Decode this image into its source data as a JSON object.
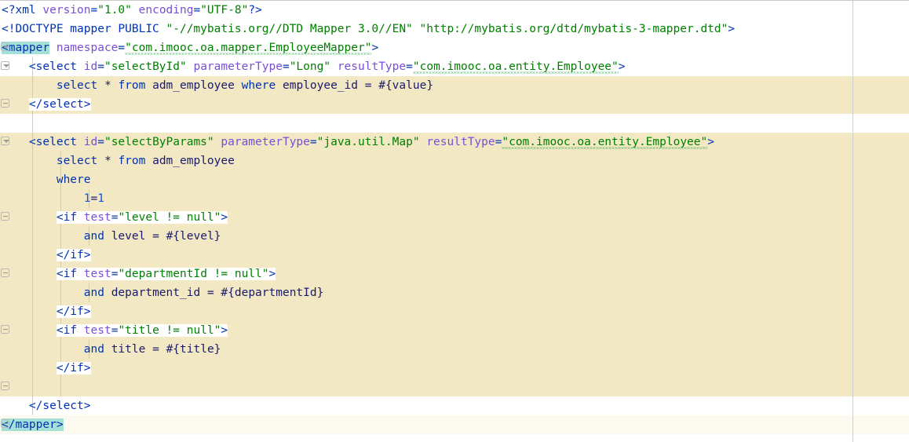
{
  "editor": {
    "kind": "xml-code-editor",
    "file_language": "XML",
    "font_size_px": 14.5,
    "line_height_px": 24,
    "colors": {
      "background": "#ffffff",
      "highlight_band": "#f2e8c3",
      "caret_line": "#fcfaef",
      "tag_selection": "#a5e0d8",
      "tag_name": "#0033b3",
      "attribute_name": "#7a4fd6",
      "attribute_value": "#008000",
      "sql_keyword": "#0033b3",
      "sql_identifier": "#1a1a6e",
      "number": "#1750eb",
      "indent_guide": "#cfcbbb",
      "margin_rule": "#cfcfcf",
      "fold_marker": "#b9b9b9",
      "spellcheck_squiggle": "#2fa84f"
    },
    "margin_rule_x": 1086,
    "indent_guides_x": [
      41,
      77,
      113
    ],
    "gutter": {
      "fold_markers": [
        {
          "line": 3,
          "state": "expanded"
        },
        {
          "line": 4,
          "state": "expanded"
        },
        {
          "line": 6,
          "state": "end"
        },
        {
          "line": 8,
          "state": "expanded"
        },
        {
          "line": 12,
          "state": "end"
        },
        {
          "line": 15,
          "state": "end"
        },
        {
          "line": 18,
          "state": "end"
        },
        {
          "line": 21,
          "state": "end"
        },
        {
          "line": 23,
          "state": "end"
        }
      ]
    },
    "highlight_bands": [
      {
        "from_line": 5,
        "to_line": 6,
        "type": "block"
      },
      {
        "from_line": 8,
        "to_line": 21,
        "type": "block"
      },
      {
        "from_line": 23,
        "to_line": 23,
        "type": "caret"
      }
    ],
    "lines": [
      {
        "n": 1,
        "text": "<?xml version=\"1.0\" encoding=\"UTF-8\"?>",
        "runs": [
          {
            "t": "<?xml ",
            "c": "pi"
          },
          {
            "t": "version",
            "c": "attrname"
          },
          {
            "t": "=",
            "c": "eq"
          },
          {
            "t": "\"1.0\"",
            "c": "attrval"
          },
          {
            "t": " ",
            "c": "txt"
          },
          {
            "t": "encoding",
            "c": "attrname"
          },
          {
            "t": "=",
            "c": "eq"
          },
          {
            "t": "\"UTF-8\"",
            "c": "attrval"
          },
          {
            "t": "?>",
            "c": "pi"
          }
        ]
      },
      {
        "n": 2,
        "text": "<!DOCTYPE mapper PUBLIC \"-//mybatis.org//DTD Mapper 3.0//EN\" \"http://mybatis.org/dtd/mybatis-3-mapper.dtd\">",
        "runs": [
          {
            "t": "<!DOCTYPE mapper PUBLIC ",
            "c": "doctype"
          },
          {
            "t": "\"-//mybatis.org//DTD Mapper 3.0//EN\"",
            "c": "dtname"
          },
          {
            "t": " ",
            "c": "txt"
          },
          {
            "t": "\"http://mybatis.org/dtd/mybatis-3-mapper.dtd\"",
            "c": "dtname"
          },
          {
            "t": ">",
            "c": "doctype"
          }
        ]
      },
      {
        "n": 3,
        "text": "<mapper namespace=\"com.imooc.oa.mapper.EmployeeMapper\">",
        "runs": [
          {
            "t": "<mapper",
            "c": "tagname",
            "sel": true
          },
          {
            "t": " ",
            "c": "txt"
          },
          {
            "t": "namespace",
            "c": "attrname"
          },
          {
            "t": "=",
            "c": "eq"
          },
          {
            "t": "\"com.imooc.oa.mapper.EmployeeMapper\"",
            "c": "attrval",
            "squiggle": true
          },
          {
            "t": ">",
            "c": "tagname"
          }
        ]
      },
      {
        "n": 4,
        "text": "    <select id=\"selectById\" parameterType=\"Long\" resultType=\"com.imooc.oa.entity.Employee\">",
        "runs": [
          {
            "t": "    ",
            "c": "txt"
          },
          {
            "t": "<select",
            "c": "tagname"
          },
          {
            "t": " ",
            "c": "txt"
          },
          {
            "t": "id",
            "c": "attrname"
          },
          {
            "t": "=",
            "c": "eq"
          },
          {
            "t": "\"selectById\"",
            "c": "attrval"
          },
          {
            "t": " ",
            "c": "txt"
          },
          {
            "t": "parameterType",
            "c": "attrname"
          },
          {
            "t": "=",
            "c": "eq"
          },
          {
            "t": "\"Long\"",
            "c": "attrval"
          },
          {
            "t": " ",
            "c": "txt"
          },
          {
            "t": "resultType",
            "c": "attrname"
          },
          {
            "t": "=",
            "c": "eq"
          },
          {
            "t": "\"com.imooc.oa.entity.Employee\"",
            "c": "attrval",
            "squiggle": true
          },
          {
            "t": ">",
            "c": "tagname"
          }
        ]
      },
      {
        "n": 5,
        "text": "        select * from adm_employee where employee_id = #{value}",
        "runs": [
          {
            "t": "        ",
            "c": "txt"
          },
          {
            "t": "select",
            "c": "kw"
          },
          {
            "t": " ",
            "c": "txt"
          },
          {
            "t": "*",
            "c": "op"
          },
          {
            "t": " ",
            "c": "txt"
          },
          {
            "t": "from",
            "c": "kw"
          },
          {
            "t": " ",
            "c": "txt"
          },
          {
            "t": "adm_employee",
            "c": "ident"
          },
          {
            "t": " ",
            "c": "txt"
          },
          {
            "t": "where",
            "c": "kw"
          },
          {
            "t": " ",
            "c": "txt"
          },
          {
            "t": "employee_id",
            "c": "ident"
          },
          {
            "t": " ",
            "c": "txt"
          },
          {
            "t": "=",
            "c": "op"
          },
          {
            "t": " ",
            "c": "txt"
          },
          {
            "t": "#{value}",
            "c": "ident"
          }
        ]
      },
      {
        "n": 6,
        "text": "    </select>",
        "runs": [
          {
            "t": "    ",
            "c": "txt"
          },
          {
            "t": "</select>",
            "c": "tagname",
            "island": true
          }
        ]
      },
      {
        "n": 7,
        "text": "",
        "runs": []
      },
      {
        "n": 8,
        "text": "    <select id=\"selectByParams\" parameterType=\"java.util.Map\" resultType=\"com.imooc.oa.entity.Employee\">",
        "runs": [
          {
            "t": "    ",
            "c": "txt"
          },
          {
            "t": "<select",
            "c": "tagname"
          },
          {
            "t": " ",
            "c": "txt"
          },
          {
            "t": "id",
            "c": "attrname"
          },
          {
            "t": "=",
            "c": "eq"
          },
          {
            "t": "\"selectByParams\"",
            "c": "attrval"
          },
          {
            "t": " ",
            "c": "txt"
          },
          {
            "t": "parameterType",
            "c": "attrname"
          },
          {
            "t": "=",
            "c": "eq"
          },
          {
            "t": "\"java.util.Map\"",
            "c": "attrval"
          },
          {
            "t": " ",
            "c": "txt"
          },
          {
            "t": "resultType",
            "c": "attrname"
          },
          {
            "t": "=",
            "c": "eq"
          },
          {
            "t": "\"com.imooc.oa.entity.Employee\"",
            "c": "attrval",
            "squiggle": true
          },
          {
            "t": ">",
            "c": "tagname"
          }
        ]
      },
      {
        "n": 9,
        "text": "        select * from adm_employee",
        "runs": [
          {
            "t": "        ",
            "c": "txt"
          },
          {
            "t": "select",
            "c": "kw"
          },
          {
            "t": " ",
            "c": "txt"
          },
          {
            "t": "*",
            "c": "op"
          },
          {
            "t": " ",
            "c": "txt"
          },
          {
            "t": "from",
            "c": "kw"
          },
          {
            "t": " ",
            "c": "txt"
          },
          {
            "t": "adm_employee",
            "c": "ident"
          }
        ]
      },
      {
        "n": 10,
        "text": "        where",
        "runs": [
          {
            "t": "        ",
            "c": "txt"
          },
          {
            "t": "where",
            "c": "kw"
          }
        ]
      },
      {
        "n": 11,
        "text": "            1=1",
        "runs": [
          {
            "t": "            ",
            "c": "txt"
          },
          {
            "t": "1",
            "c": "num"
          },
          {
            "t": "=",
            "c": "op"
          },
          {
            "t": "1",
            "c": "num"
          }
        ]
      },
      {
        "n": 12,
        "text": "        <if test=\"level != null\">",
        "runs": [
          {
            "t": "        ",
            "c": "txt"
          },
          {
            "t": "<if",
            "c": "tagname",
            "island": true
          },
          {
            "t": " ",
            "c": "txt",
            "island": true
          },
          {
            "t": "test",
            "c": "attrname",
            "island": true
          },
          {
            "t": "=",
            "c": "eq",
            "island": true
          },
          {
            "t": "\"level != null\"",
            "c": "attrval",
            "island": true
          },
          {
            "t": ">",
            "c": "tagname",
            "island": true
          }
        ]
      },
      {
        "n": 13,
        "text": "            and level = #{level}",
        "runs": [
          {
            "t": "            ",
            "c": "txt"
          },
          {
            "t": "and",
            "c": "kw"
          },
          {
            "t": " ",
            "c": "txt"
          },
          {
            "t": "level",
            "c": "ident"
          },
          {
            "t": " ",
            "c": "txt"
          },
          {
            "t": "=",
            "c": "op"
          },
          {
            "t": " ",
            "c": "txt"
          },
          {
            "t": "#{level}",
            "c": "ident"
          }
        ]
      },
      {
        "n": 14,
        "text": "        </if>",
        "runs": [
          {
            "t": "        ",
            "c": "txt"
          },
          {
            "t": "</if>",
            "c": "tagname",
            "island": true
          }
        ]
      },
      {
        "n": 15,
        "text": "        <if test=\"departmentId != null\">",
        "runs": [
          {
            "t": "        ",
            "c": "txt"
          },
          {
            "t": "<if",
            "c": "tagname",
            "island": true
          },
          {
            "t": " ",
            "c": "txt",
            "island": true
          },
          {
            "t": "test",
            "c": "attrname",
            "island": true
          },
          {
            "t": "=",
            "c": "eq",
            "island": true
          },
          {
            "t": "\"departmentId != null\"",
            "c": "attrval",
            "island": true
          },
          {
            "t": ">",
            "c": "tagname",
            "island": true
          }
        ]
      },
      {
        "n": 16,
        "text": "            and department_id = #{departmentId}",
        "runs": [
          {
            "t": "            ",
            "c": "txt"
          },
          {
            "t": "and",
            "c": "kw"
          },
          {
            "t": " ",
            "c": "txt"
          },
          {
            "t": "department_id",
            "c": "ident"
          },
          {
            "t": " ",
            "c": "txt"
          },
          {
            "t": "=",
            "c": "op"
          },
          {
            "t": " ",
            "c": "txt"
          },
          {
            "t": "#{departmentId}",
            "c": "ident"
          }
        ]
      },
      {
        "n": 17,
        "text": "        </if>",
        "runs": [
          {
            "t": "        ",
            "c": "txt"
          },
          {
            "t": "</if>",
            "c": "tagname",
            "island": true
          }
        ]
      },
      {
        "n": 18,
        "text": "        <if test=\"title != null\">",
        "runs": [
          {
            "t": "        ",
            "c": "txt"
          },
          {
            "t": "<if",
            "c": "tagname",
            "island": true
          },
          {
            "t": " ",
            "c": "txt",
            "island": true
          },
          {
            "t": "test",
            "c": "attrname",
            "island": true
          },
          {
            "t": "=",
            "c": "eq",
            "island": true
          },
          {
            "t": "\"title != null\"",
            "c": "attrval",
            "island": true
          },
          {
            "t": ">",
            "c": "tagname",
            "island": true
          }
        ]
      },
      {
        "n": 19,
        "text": "            and title = #{title}",
        "runs": [
          {
            "t": "            ",
            "c": "txt"
          },
          {
            "t": "and",
            "c": "kw"
          },
          {
            "t": " ",
            "c": "txt"
          },
          {
            "t": "title",
            "c": "ident"
          },
          {
            "t": " ",
            "c": "txt"
          },
          {
            "t": "=",
            "c": "op"
          },
          {
            "t": " ",
            "c": "txt"
          },
          {
            "t": "#{title}",
            "c": "ident"
          }
        ]
      },
      {
        "n": 20,
        "text": "        </if>",
        "runs": [
          {
            "t": "        ",
            "c": "txt"
          },
          {
            "t": "</if>",
            "c": "tagname",
            "island": true
          }
        ]
      },
      {
        "n": 21,
        "text": "",
        "runs": []
      },
      {
        "n": 22,
        "text": "    </select>",
        "runs": [
          {
            "t": "    ",
            "c": "txt"
          },
          {
            "t": "</select>",
            "c": "tagname"
          }
        ]
      },
      {
        "n": 23,
        "text": "</mapper>",
        "runs": [
          {
            "t": "</mapper>",
            "c": "tagname",
            "sel": true
          }
        ]
      }
    ]
  }
}
